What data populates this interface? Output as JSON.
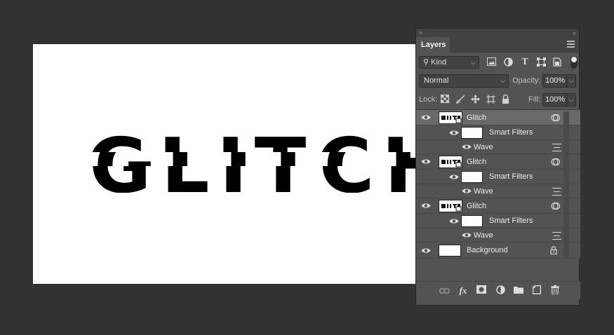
{
  "canvas": {
    "text": "GLITCH",
    "background": "#ffffff",
    "text_color": "#000000"
  },
  "panel": {
    "title": "Layers",
    "close_glyph": "×",
    "collapse_glyph": "‹‹",
    "filter": {
      "kind_label": "Kind",
      "icons": [
        "image-filter-icon",
        "adjustment-filter-icon",
        "type-filter-icon",
        "shape-filter-icon",
        "smart-object-filter-icon"
      ],
      "type_glyph": "T"
    },
    "blend_mode": "Normal",
    "opacity_label": "Opacity:",
    "opacity_value": "100%",
    "lock_label": "Lock:",
    "fill_label": "Fill:",
    "fill_value": "100%",
    "layers": [
      {
        "name": "Glitch",
        "type": "smart-object",
        "selected": true
      },
      {
        "name": "Smart Filters",
        "type": "smart-filters"
      },
      {
        "name": "Wave",
        "type": "filter"
      },
      {
        "name": "Glitch",
        "type": "smart-object",
        "selected": false
      },
      {
        "name": "Smart Filters",
        "type": "smart-filters"
      },
      {
        "name": "Wave",
        "type": "filter"
      },
      {
        "name": "Glitch",
        "type": "smart-object",
        "selected": false
      },
      {
        "name": "Smart Filters",
        "type": "smart-filters"
      },
      {
        "name": "Wave",
        "type": "filter"
      },
      {
        "name": "Background",
        "type": "background",
        "locked": true
      }
    ],
    "bottom_icons": [
      "link-layers-icon",
      "fx-icon",
      "mask-icon",
      "adjustment-layer-icon",
      "group-folder-icon",
      "new-layer-icon",
      "trash-icon"
    ],
    "fx_glyph": "fx"
  },
  "colors": {
    "workspace": "#323232",
    "panel": "#535353",
    "selected_row": "#696969"
  }
}
